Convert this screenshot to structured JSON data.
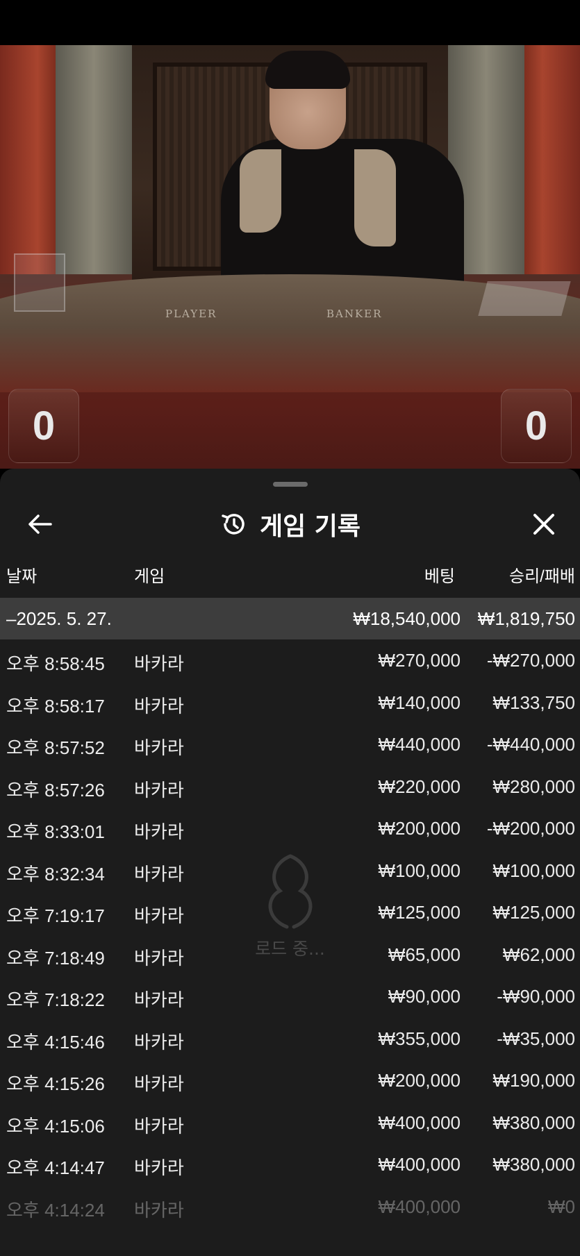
{
  "video": {
    "table_left_label": "PLAYER",
    "table_right_label": "BANKER",
    "score_left": "0",
    "score_right": "0"
  },
  "sheet": {
    "title": "게임 기록",
    "icons": {
      "back": "arrow-left-icon",
      "history": "history-icon",
      "close": "close-icon"
    },
    "columns": {
      "date": "날짜",
      "game": "게임",
      "bet": "베팅",
      "win_loss": "승리/패배"
    },
    "summary": {
      "date": "–2025. 5. 27.",
      "bet": "₩18,540,000",
      "win_loss": "₩1,819,750"
    },
    "rows": [
      {
        "time": "오후 8:58:45",
        "game": "바카라",
        "bet": "₩270,000",
        "win_loss": "-₩270,000"
      },
      {
        "time": "오후 8:58:17",
        "game": "바카라",
        "bet": "₩140,000",
        "win_loss": "₩133,750"
      },
      {
        "time": "오후 8:57:52",
        "game": "바카라",
        "bet": "₩440,000",
        "win_loss": "-₩440,000"
      },
      {
        "time": "오후 8:57:26",
        "game": "바카라",
        "bet": "₩220,000",
        "win_loss": "₩280,000"
      },
      {
        "time": "오후 8:33:01",
        "game": "바카라",
        "bet": "₩200,000",
        "win_loss": "-₩200,000"
      },
      {
        "time": "오후 8:32:34",
        "game": "바카라",
        "bet": "₩100,000",
        "win_loss": "₩100,000"
      },
      {
        "time": "오후 7:19:17",
        "game": "바카라",
        "bet": "₩125,000",
        "win_loss": "₩125,000"
      },
      {
        "time": "오후 7:18:49",
        "game": "바카라",
        "bet": "₩65,000",
        "win_loss": "₩62,000"
      },
      {
        "time": "오후 7:18:22",
        "game": "바카라",
        "bet": "₩90,000",
        "win_loss": "-₩90,000"
      },
      {
        "time": "오후 4:15:46",
        "game": "바카라",
        "bet": "₩355,000",
        "win_loss": "-₩35,000"
      },
      {
        "time": "오후 4:15:26",
        "game": "바카라",
        "bet": "₩200,000",
        "win_loss": "₩190,000"
      },
      {
        "time": "오후 4:15:06",
        "game": "바카라",
        "bet": "₩400,000",
        "win_loss": "₩380,000"
      },
      {
        "time": "오후 4:14:47",
        "game": "바카라",
        "bet": "₩400,000",
        "win_loss": "₩380,000"
      },
      {
        "time": "오후 4:14:24",
        "game": "바카라",
        "bet": "₩400,000",
        "win_loss": "₩0"
      }
    ],
    "loading_text": "로드 중..."
  }
}
